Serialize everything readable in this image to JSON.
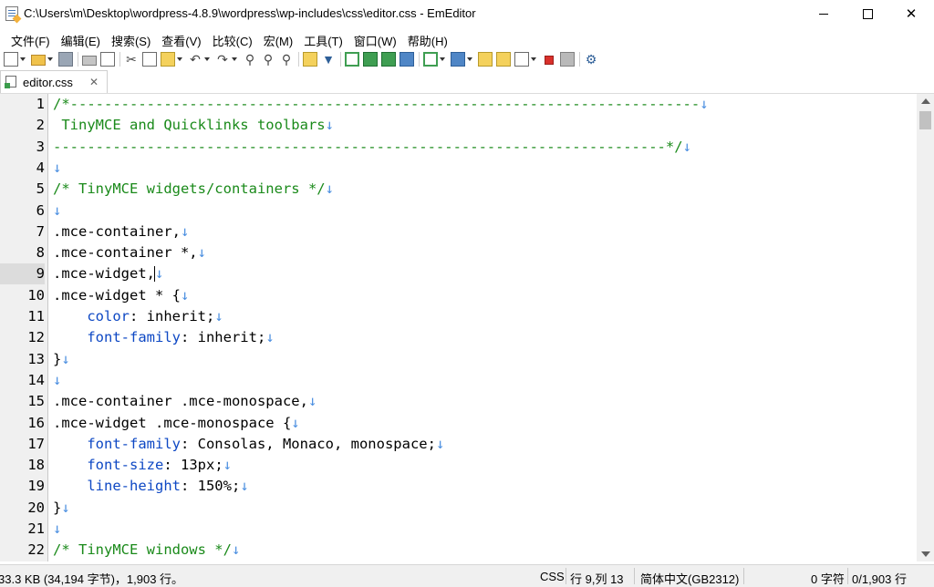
{
  "window": {
    "title": "C:\\Users\\m\\Desktop\\wordpress-4.8.9\\wordpress\\wp-includes\\css\\editor.css - EmEditor",
    "minimize": "—",
    "maximize": "☐",
    "close": "✕"
  },
  "menu": [
    "文件(F)",
    "编辑(E)",
    "搜索(S)",
    "查看(V)",
    "比较(C)",
    "宏(M)",
    "工具(T)",
    "窗口(W)",
    "帮助(H)"
  ],
  "toolbar_icons": [
    "new-file-icon",
    "open-folder-icon",
    "save-icon",
    "print-icon",
    "print-preview-icon",
    "cut-icon",
    "copy-icon",
    "paste-icon",
    "undo-icon",
    "redo-icon",
    "find-icon",
    "find-next-icon",
    "find-prev-icon",
    "find-in-files-icon",
    "filter-icon",
    "wrap-none-icon",
    "wrap-window-icon",
    "wrap-char-icon",
    "wrap-page-icon",
    "bookmark-icon",
    "outline-icon",
    "snippets-icon",
    "word-count-icon",
    "select-mode-icon",
    "record-macro-icon",
    "run-macro-icon",
    "settings-icon"
  ],
  "tab": {
    "label": "editor.css",
    "close": "✕"
  },
  "eol_mark": "↓",
  "colors": {
    "comment": "#1a8a1a",
    "property": "#0e48c4",
    "eol": "#4a8ee0"
  },
  "editor_lines": [
    {
      "n": "1",
      "parts": [
        {
          "t": "/*--------------------------------------------------------------------------",
          "c": "cm"
        }
      ]
    },
    {
      "n": "2",
      "parts": [
        {
          "t": " TinyMCE and Quicklinks toolbars",
          "c": "cm"
        }
      ]
    },
    {
      "n": "3",
      "parts": [
        {
          "t": "------------------------------------------------------------------------*/",
          "c": "cm"
        }
      ]
    },
    {
      "n": "4",
      "parts": []
    },
    {
      "n": "5",
      "parts": [
        {
          "t": "/* TinyMCE widgets/containers */",
          "c": "cm"
        }
      ]
    },
    {
      "n": "6",
      "parts": []
    },
    {
      "n": "7",
      "parts": [
        {
          "t": ".mce-container,",
          "c": "tx"
        }
      ]
    },
    {
      "n": "8",
      "parts": [
        {
          "t": ".mce-container *,",
          "c": "tx"
        }
      ]
    },
    {
      "n": "9",
      "parts": [
        {
          "t": ".mce-widget,",
          "c": "tx"
        }
      ],
      "current": true
    },
    {
      "n": "10",
      "parts": [
        {
          "t": ".mce-widget * {",
          "c": "tx"
        }
      ]
    },
    {
      "n": "11",
      "parts": [
        {
          "t": "    ",
          "c": "tx"
        },
        {
          "t": "color",
          "c": "kw"
        },
        {
          "t": ": inherit;",
          "c": "tx"
        }
      ]
    },
    {
      "n": "12",
      "parts": [
        {
          "t": "    ",
          "c": "tx"
        },
        {
          "t": "font-family",
          "c": "kw"
        },
        {
          "t": ": inherit;",
          "c": "tx"
        }
      ]
    },
    {
      "n": "13",
      "parts": [
        {
          "t": "}",
          "c": "tx"
        }
      ]
    },
    {
      "n": "14",
      "parts": []
    },
    {
      "n": "15",
      "parts": [
        {
          "t": ".mce-container .mce-monospace,",
          "c": "tx"
        }
      ]
    },
    {
      "n": "16",
      "parts": [
        {
          "t": ".mce-widget .mce-monospace {",
          "c": "tx"
        }
      ]
    },
    {
      "n": "17",
      "parts": [
        {
          "t": "    ",
          "c": "tx"
        },
        {
          "t": "font-family",
          "c": "kw"
        },
        {
          "t": ": Consolas, Monaco, monospace;",
          "c": "tx"
        }
      ]
    },
    {
      "n": "18",
      "parts": [
        {
          "t": "    ",
          "c": "tx"
        },
        {
          "t": "font-size",
          "c": "kw"
        },
        {
          "t": ": 13px;",
          "c": "tx"
        }
      ]
    },
    {
      "n": "19",
      "parts": [
        {
          "t": "    ",
          "c": "tx"
        },
        {
          "t": "line-height",
          "c": "kw"
        },
        {
          "t": ": 150%;",
          "c": "tx"
        }
      ]
    },
    {
      "n": "20",
      "parts": [
        {
          "t": "}",
          "c": "tx"
        }
      ]
    },
    {
      "n": "21",
      "parts": []
    },
    {
      "n": "22",
      "parts": [
        {
          "t": "/* TinyMCE windows */",
          "c": "cm"
        }
      ]
    }
  ],
  "status": {
    "size": "33.3 KB (34,194 字节)，1,903 行。",
    "language": "CSS",
    "position": "行 9,列 13",
    "encoding": "简体中文(GB2312)",
    "chars": "0 字符",
    "lines": "0/1,903 行"
  }
}
